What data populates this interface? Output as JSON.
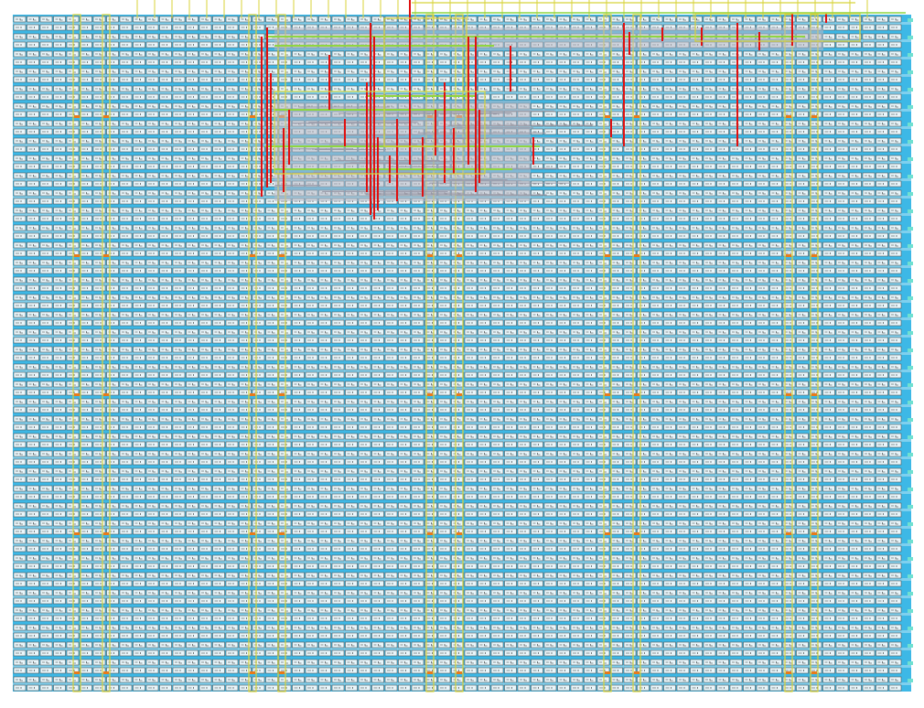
{
  "title": "",
  "colors": {
    "background": "#ffffff",
    "cell_fill": "#3db8e6",
    "cell_stripe": "#7fd0ee",
    "cell_outline": "#555555",
    "cell_glyph": "#2a2a2a",
    "routing_yellow": "#d8d33a",
    "routing_green": "#8fd640",
    "wire_red": "#e01010",
    "overlay_gray": "#b8b8c4",
    "tap_orange": "#e87a1a"
  },
  "legend": []
}
